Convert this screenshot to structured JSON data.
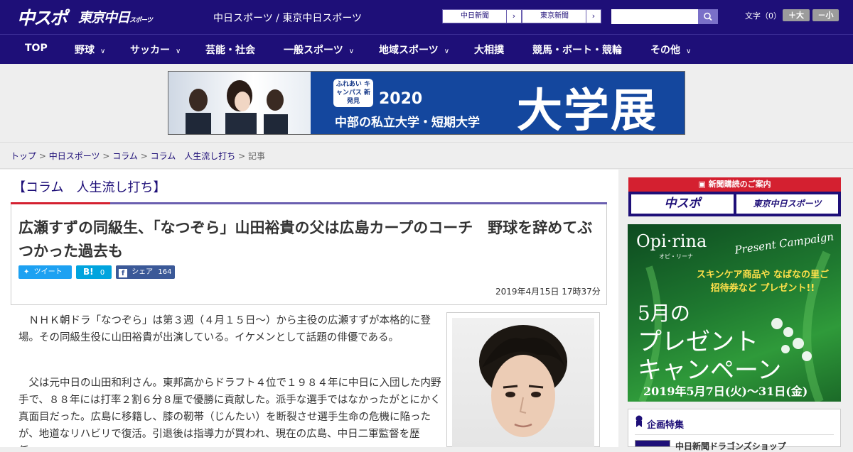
{
  "header": {
    "logo_main": "中スポ",
    "logo_tokyo": "東京中日",
    "logo_tokyo_small": "スポーツ",
    "site_title": "中日スポーツ / 東京中日スポーツ",
    "paper_links": [
      "中日新聞",
      "東京新聞"
    ],
    "search": {
      "placeholder": ""
    },
    "font_size_label": "文字（0）",
    "font_bigger": "＋大",
    "font_smaller": "－小"
  },
  "nav": {
    "items": [
      {
        "label": "TOP",
        "dropdown": false
      },
      {
        "label": "野球",
        "dropdown": true
      },
      {
        "label": "サッカー",
        "dropdown": true
      },
      {
        "label": "芸能・社会",
        "dropdown": false
      },
      {
        "label": "一般スポーツ",
        "dropdown": true
      },
      {
        "label": "地域スポーツ",
        "dropdown": true
      },
      {
        "label": "大相撲",
        "dropdown": false
      },
      {
        "label": "競馬・ボート・競輪",
        "dropdown": false
      },
      {
        "label": "その他",
        "dropdown": true
      }
    ]
  },
  "banner": {
    "badge": "ふれあい キャンパス 新発見",
    "year": "2020",
    "subtitle": "中部の私立大学・短期大学",
    "big_text": "大学展"
  },
  "breadcrumb": {
    "items": [
      "トップ",
      "中日スポーツ",
      "コラム",
      "コラム　人生流し打ち"
    ],
    "current": "記事",
    "separator": ">"
  },
  "article": {
    "column_title": "【コラム　人生流し打ち】",
    "headline": "広瀬すずの同級生、「なつぞら」山田裕貴の父は広島カープのコーチ　野球を辞めてぶつかった過去も",
    "share": {
      "tweet": "ツイート",
      "hatena_label": "B!",
      "hatena_count": "0",
      "facebook_label": "シェア",
      "facebook_count": "164"
    },
    "date": "2019年4月15日 17時37分",
    "paragraphs": [
      "ＮＨＫ朝ドラ「なつぞら」は第３週（４月１５日～）から主役の広瀬すずが本格的に登場。その同級生役に山田裕貴が出演している。イケメンとして話題の俳優である。",
      "父は元中日の山田和利さん。東邦高からドラフト４位で１９８４年に中日に入団した内野手で、８８年には打率２割６分８厘で優勝に貢献した。派手な選手ではなかったがとにかく真面目だった。広島に移籍し、膝の靭帯（じんたい）を断裂させ選手生命の危機に陥ったが、地道なリハビリで復活。引退後は指導力が買われ、現在の広島、中日二軍監督を歴任……"
    ]
  },
  "sidebar": {
    "subscribe_header": "新聞購読のご案内",
    "subscribe_logos": [
      "中スポ",
      "東京中日スポーツ"
    ],
    "ad": {
      "brand": "Opi·rina",
      "brand_kana": "オピ・リーナ",
      "campaign": "Present Campaign",
      "tag": "スキンケア商品や なばなの里ご招待券など プレゼント!!",
      "big1": "5月の",
      "big2": "プレゼント",
      "big3": "キャンペーン",
      "dates": "2019年5月7日(火)～31日(金)"
    },
    "feature_title": "企画特集",
    "feature_item": "中日新聞ドラゴンズショップ"
  }
}
